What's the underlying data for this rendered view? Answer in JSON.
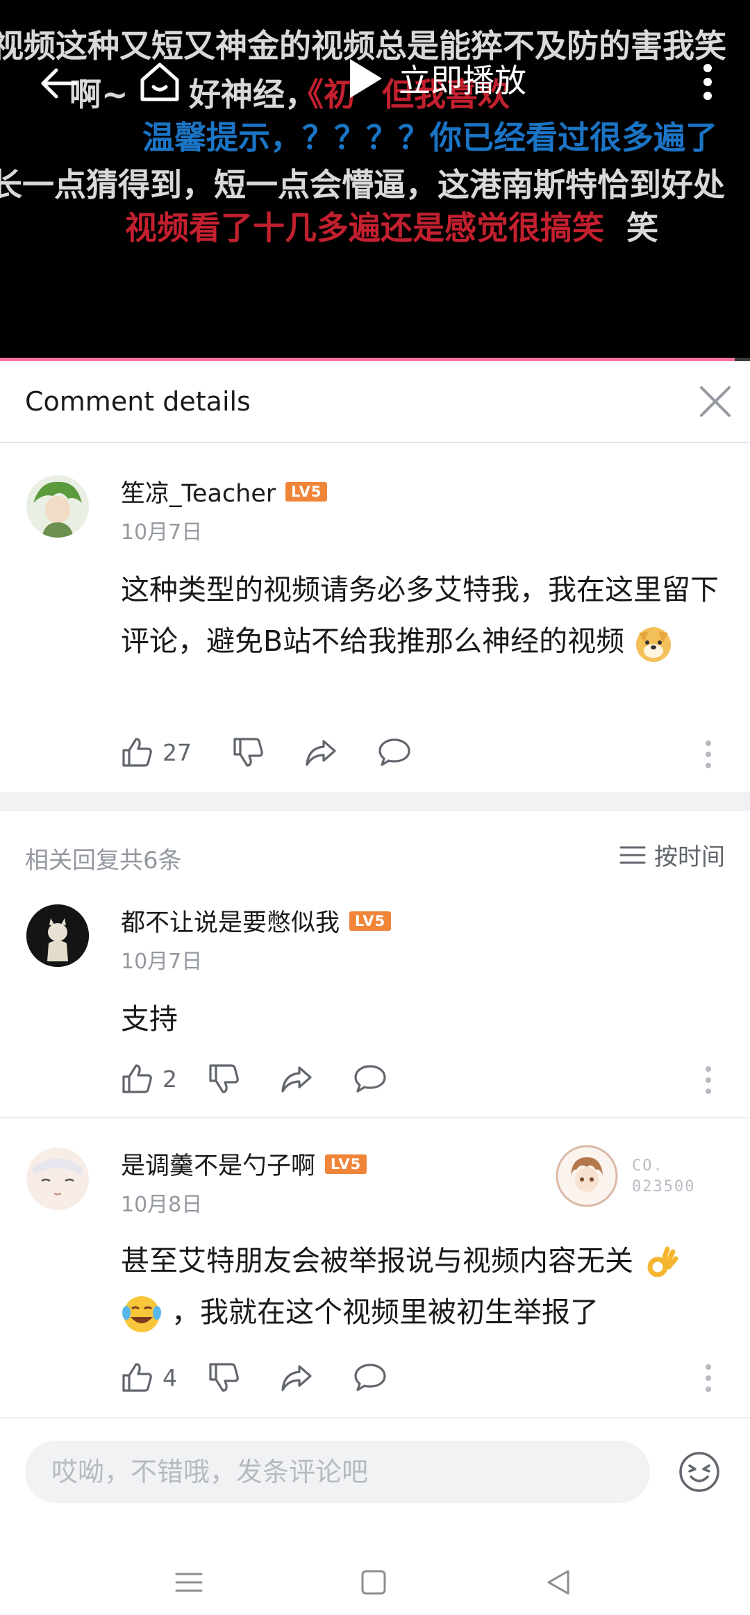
{
  "video": {
    "play_now_label": "立即播放",
    "progress_fraction": 0.98,
    "danmaku": [
      "视频这种又短又神金的视频总是能猝不及防的害我笑",
      "啊~",
      "好神经，",
      "《初",
      "但我喜欢",
      "温馨提示，？？？？你已经看过很多遍了",
      "长一点猜得到，短一点会懵逼，这港南斯特恰到好处",
      "视频看了十几多遍还是感觉很搞笑",
      "笑"
    ]
  },
  "panel": {
    "title": "Comment details"
  },
  "main_comment": {
    "username": "笙凉_Teacher",
    "level": "LV5",
    "date": "10月7日",
    "text": "这种类型的视频请务必多艾特我，我在这里留下评论，避免B站不给我推那么神经的视频",
    "likes": "27"
  },
  "replies_header": {
    "count_label": "相关回复共6条",
    "sort_label": "按时间"
  },
  "replies": [
    {
      "username": "都不让说是要憋似我",
      "level": "LV5",
      "date": "10月7日",
      "text": "支持",
      "likes": "2"
    },
    {
      "username": "是调羹不是勺子啊",
      "level": "LV5",
      "date": "10月8日",
      "text_line1": "甚至艾特朋友会被举报说与视频内容无关",
      "text_line2": "，我就在这个视频里被初生举报了",
      "likes": "4",
      "pendant_text_line1": "CO.",
      "pendant_text_line2": "023500"
    }
  ],
  "composer": {
    "placeholder": "哎呦，不错哦，发条评论吧"
  },
  "colors": {
    "accent": "#fb7299",
    "level_badge": "#f0853a",
    "secondary_text": "#9499a0"
  }
}
